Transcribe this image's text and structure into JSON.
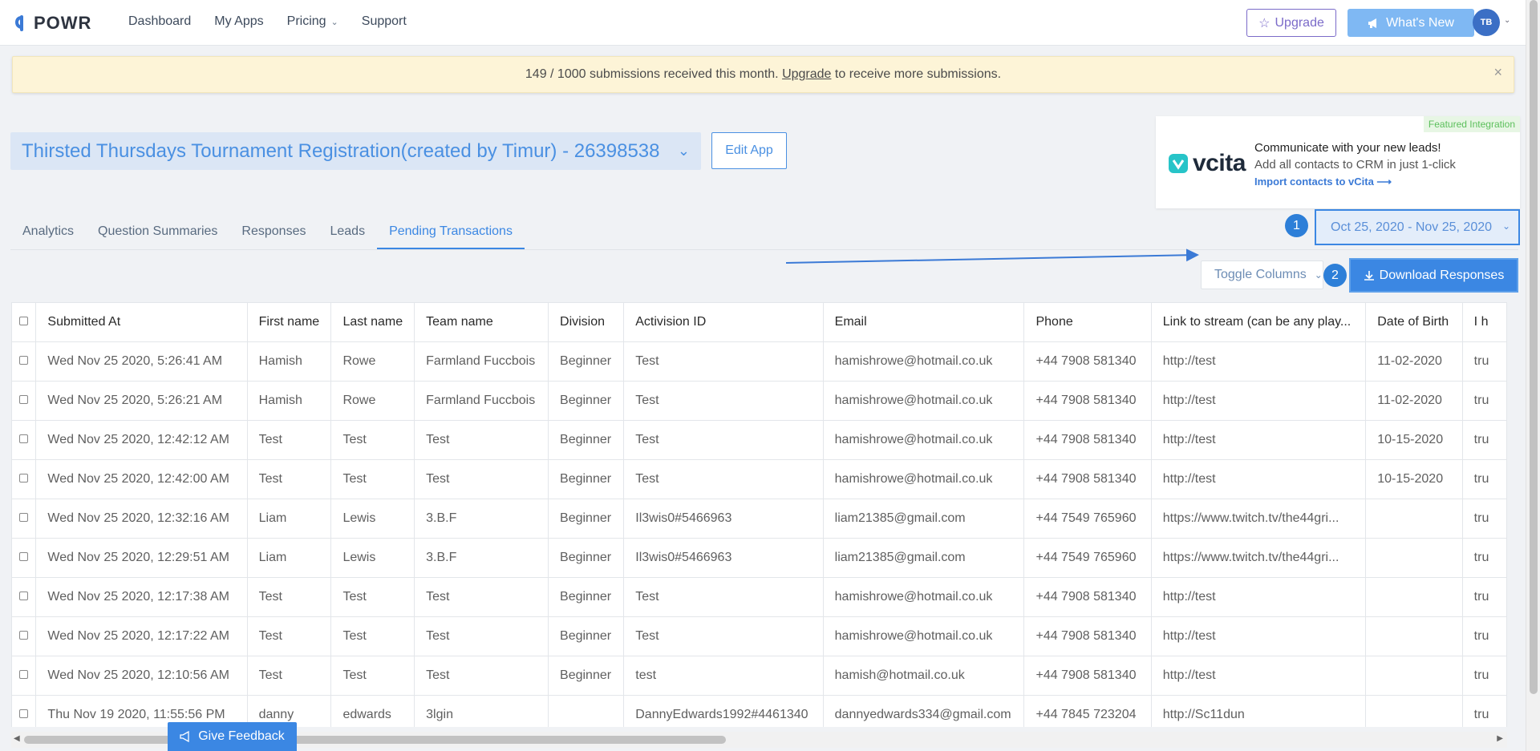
{
  "nav": {
    "brand": "POWR",
    "links": [
      "Dashboard",
      "My Apps",
      "Pricing",
      "Support"
    ],
    "upgrade_label": "Upgrade",
    "whats_new_label": "What's New",
    "avatar_initials": "TB"
  },
  "banner": {
    "text_before": "149 / 1000 submissions received this month. ",
    "link": "Upgrade",
    "text_after": " to receive more submissions.",
    "close": "×"
  },
  "app": {
    "title": "Thirsted Thursdays Tournament Registration(created by Timur) - 26398538",
    "edit_label": "Edit App"
  },
  "vcita": {
    "badge": "Featured Integration",
    "wordmark": "vcita",
    "headline": "Communicate with your new leads!",
    "subline": "Add all contacts to CRM in just 1-click",
    "link": "Import contacts to vCita ⟶"
  },
  "tabs": [
    "Analytics",
    "Question Summaries",
    "Responses",
    "Leads",
    "Pending Transactions"
  ],
  "active_tab": "Pending Transactions",
  "date_range": "Oct 25, 2020 - Nov 25, 2020",
  "steps": [
    "1",
    "2"
  ],
  "toggle_columns_label": "Toggle Columns",
  "download_label": "Download Responses",
  "feedback_label": "Give Feedback",
  "colors": {
    "accent": "#3b87e3",
    "banner_bg": "#fdf4d7",
    "upgrade": "#7b6bc9"
  },
  "table": {
    "headers": [
      "Submitted At",
      "First name",
      "Last name",
      "Team name",
      "Division",
      "Activision ID",
      "Email",
      "Phone",
      "Link to stream (can be any play...",
      "Date of Birth",
      "I h"
    ],
    "rows": [
      [
        "Wed Nov 25 2020, 5:26:41 AM",
        "Hamish",
        "Rowe",
        "Farmland Fuccbois",
        "Beginner",
        "Test",
        "hamishrowe@hotmail.co.uk",
        "+44 7908 581340",
        "http://test",
        "11-02-2020",
        "tru"
      ],
      [
        "Wed Nov 25 2020, 5:26:21 AM",
        "Hamish",
        "Rowe",
        "Farmland Fuccbois",
        "Beginner",
        "Test",
        "hamishrowe@hotmail.co.uk",
        "+44 7908 581340",
        "http://test",
        "11-02-2020",
        "tru"
      ],
      [
        "Wed Nov 25 2020, 12:42:12 AM",
        "Test",
        "Test",
        "Test",
        "Beginner",
        "Test",
        "hamishrowe@hotmail.co.uk",
        "+44 7908 581340",
        "http://test",
        "10-15-2020",
        "tru"
      ],
      [
        "Wed Nov 25 2020, 12:42:00 AM",
        "Test",
        "Test",
        "Test",
        "Beginner",
        "Test",
        "hamishrowe@hotmail.co.uk",
        "+44 7908 581340",
        "http://test",
        "10-15-2020",
        "tru"
      ],
      [
        "Wed Nov 25 2020, 12:32:16 AM",
        "Liam",
        "Lewis",
        "3.B.F",
        "Beginner",
        "Il3wis0#5466963",
        "liam21385@gmail.com",
        "+44 7549 765960",
        "https://www.twitch.tv/the44gri...",
        "",
        "tru"
      ],
      [
        "Wed Nov 25 2020, 12:29:51 AM",
        "Liam",
        "Lewis",
        "3.B.F",
        "Beginner",
        "Il3wis0#5466963",
        "liam21385@gmail.com",
        "+44 7549 765960",
        "https://www.twitch.tv/the44gri...",
        "",
        "tru"
      ],
      [
        "Wed Nov 25 2020, 12:17:38 AM",
        "Test",
        "Test",
        "Test",
        "Beginner",
        "Test",
        "hamishrowe@hotmail.co.uk",
        "+44 7908 581340",
        "http://test",
        "",
        "tru"
      ],
      [
        "Wed Nov 25 2020, 12:17:22 AM",
        "Test",
        "Test",
        "Test",
        "Beginner",
        "Test",
        "hamishrowe@hotmail.co.uk",
        "+44 7908 581340",
        "http://test",
        "",
        "tru"
      ],
      [
        "Wed Nov 25 2020, 12:10:56 AM",
        "Test",
        "Test",
        "Test",
        "Beginner",
        "test",
        "hamish@hotmail.co.uk",
        "+44 7908 581340",
        "http://test",
        "",
        "tru"
      ],
      [
        "Thu Nov 19 2020, 11:55:56 PM",
        "danny",
        "edwards",
        "3lgin",
        "",
        "DannyEdwards1992#4461340",
        "dannyedwards334@gmail.com",
        "+44 7845 723204",
        "http://Sc11dun",
        "",
        "tru"
      ]
    ]
  }
}
